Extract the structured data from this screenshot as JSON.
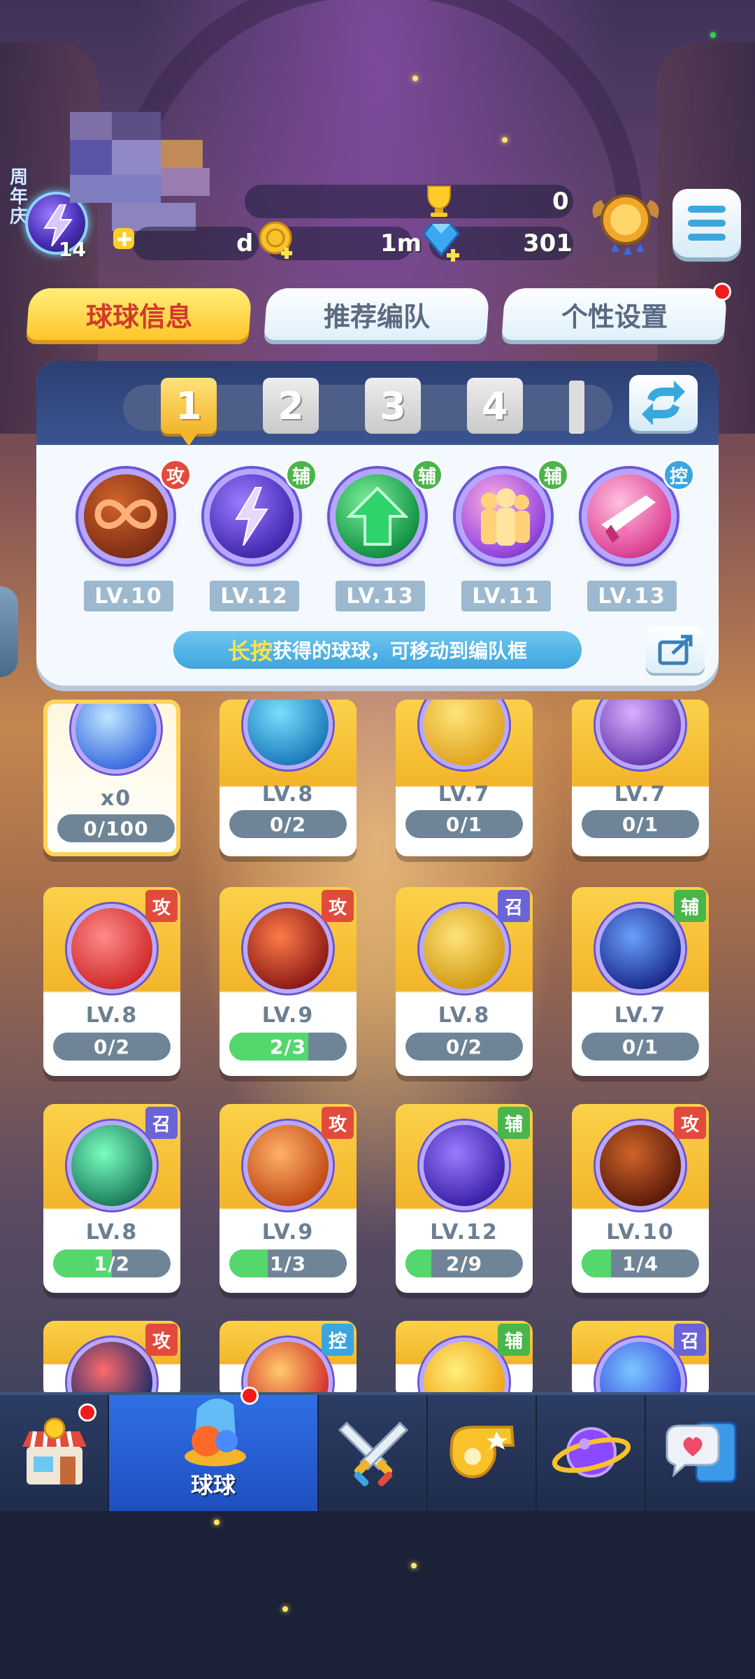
{
  "colors": {
    "tab_active_bg": "#ffc52a",
    "tab_active_text": "#d03b2a",
    "attack": "#e24a3c",
    "support": "#4ab54a",
    "control": "#3aa6e0",
    "summon": "#6b63d8",
    "progress_fill": "#54d86e"
  },
  "header": {
    "anniversary_label": "周年庆",
    "player_level": "14",
    "trophies": "0",
    "gold_d": "d",
    "coins": "1m",
    "gems": "301"
  },
  "tabs": [
    {
      "label": "球球信息",
      "active": true
    },
    {
      "label": "推荐编队",
      "active": false
    },
    {
      "label": "个性设置",
      "active": false,
      "badge": true
    }
  ],
  "team": {
    "slots": [
      "1",
      "2",
      "3",
      "4"
    ],
    "active_slot": "1",
    "members": [
      {
        "role": "攻",
        "level": "LV.10",
        "icon": "infinity-orb-icon"
      },
      {
        "role": "辅",
        "level": "LV.12",
        "icon": "lightning-orb-icon"
      },
      {
        "role": "辅",
        "level": "LV.13",
        "icon": "arrow-up-orb-icon"
      },
      {
        "role": "辅",
        "level": "LV.11",
        "icon": "clone-orb-icon"
      },
      {
        "role": "控",
        "level": "LV.13",
        "icon": "dagger-orb-icon"
      }
    ],
    "hint_highlight": "长按",
    "hint_text": "获得的球球，可移动到编队框"
  },
  "cards": [
    {
      "level": "x0",
      "progress": "0/100",
      "fill": 0,
      "tag": "",
      "icon": "swap-orb-icon"
    },
    {
      "level": "LV.8",
      "progress": "0/2",
      "fill": 0,
      "tag": "",
      "icon": "blue-fish-orb-icon"
    },
    {
      "level": "LV.7",
      "progress": "0/1",
      "fill": 0,
      "tag": "",
      "icon": "yellow-blob-orb-icon"
    },
    {
      "level": "LV.7",
      "progress": "0/1",
      "fill": 0,
      "tag": "",
      "icon": "girl-orb-icon"
    },
    {
      "level": "LV.8",
      "progress": "0/2",
      "fill": 0,
      "tag": "攻",
      "icon": "red-blob-orb-icon"
    },
    {
      "level": "LV.9",
      "progress": "2/3",
      "fill": 0.667,
      "tag": "攻",
      "icon": "trident-orb-icon"
    },
    {
      "level": "LV.8",
      "progress": "0/2",
      "fill": 0,
      "tag": "召",
      "icon": "golden-hand-orb-icon"
    },
    {
      "level": "LV.7",
      "progress": "0/1",
      "fill": 0,
      "tag": "辅",
      "icon": "hex-shield-orb-icon"
    },
    {
      "level": "LV.8",
      "progress": "1/2",
      "fill": 0.5,
      "tag": "召",
      "icon": "portal-orb-icon"
    },
    {
      "level": "LV.9",
      "progress": "1/3",
      "fill": 0.333,
      "tag": "攻",
      "icon": "fire-bird-orb-icon"
    },
    {
      "level": "LV.12",
      "progress": "2/9",
      "fill": 0.222,
      "tag": "辅",
      "icon": "lightning-orb-icon"
    },
    {
      "level": "LV.10",
      "progress": "1/4",
      "fill": 0.25,
      "tag": "攻",
      "icon": "infinity-orb-icon"
    },
    {
      "level": "",
      "progress": "",
      "fill": 0,
      "tag": "攻",
      "icon": "mask-orb-icon"
    },
    {
      "level": "",
      "progress": "",
      "fill": 0,
      "tag": "控",
      "icon": "star-burst-orb-icon"
    },
    {
      "level": "",
      "progress": "",
      "fill": 0,
      "tag": "辅",
      "icon": "sun-orb-icon"
    },
    {
      "level": "",
      "progress": "",
      "fill": 0,
      "tag": "召",
      "icon": "potion-orb-icon"
    }
  ],
  "nav": [
    {
      "label": "",
      "icon": "shop-icon",
      "badge": true
    },
    {
      "label": "球球",
      "icon": "ball-icon",
      "badge": true,
      "active": true
    },
    {
      "label": "",
      "icon": "crossed-swords-icon"
    },
    {
      "label": "",
      "icon": "whistle-icon"
    },
    {
      "label": "",
      "icon": "planet-icon"
    },
    {
      "label": "",
      "icon": "chat-heart-icon"
    }
  ]
}
